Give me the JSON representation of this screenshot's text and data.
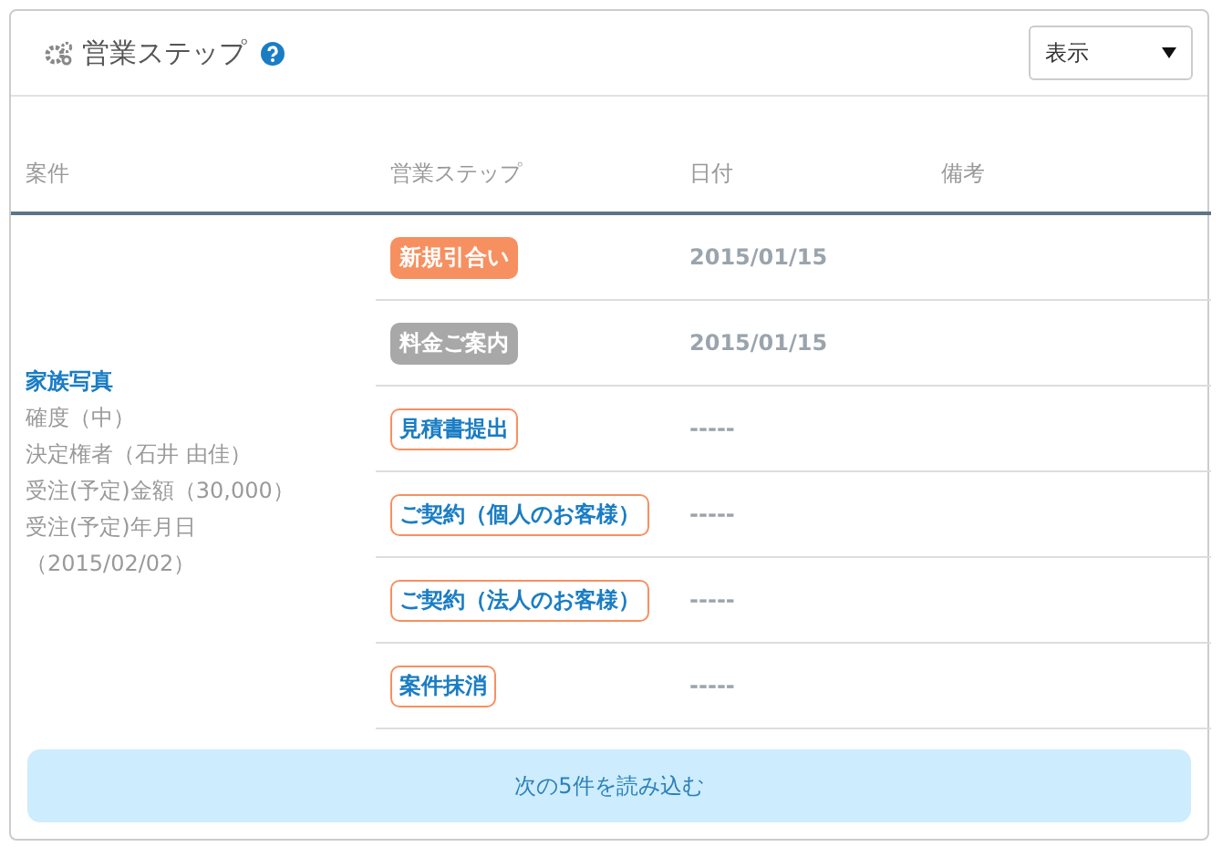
{
  "panel": {
    "title": "営業ステップ",
    "select": {
      "value": "表示"
    }
  },
  "table": {
    "columns": [
      "案件",
      "営業ステップ",
      "日付",
      "備考"
    ],
    "case": {
      "title": "家族写真",
      "details": [
        "確度（中）",
        "決定権者（石井 由佳）",
        "受注(予定)金額（30,000）",
        "受注(予定)年月日（2015/02/02）"
      ]
    },
    "rows": [
      {
        "step": "新規引合い",
        "kind": "done",
        "date": "2015/01/15"
      },
      {
        "step": "料金ご案内",
        "kind": "current",
        "date": "2015/01/15"
      },
      {
        "step": "見積書提出",
        "kind": "pending",
        "date": "-----"
      },
      {
        "step": "ご契約（個人のお客様）",
        "kind": "pending",
        "date": "-----"
      },
      {
        "step": "ご契約（法人のお客様）",
        "kind": "pending",
        "date": "-----"
      },
      {
        "step": "案件抹消",
        "kind": "pending",
        "date": "-----"
      }
    ]
  },
  "load_more": "次の5件を読み込む"
}
